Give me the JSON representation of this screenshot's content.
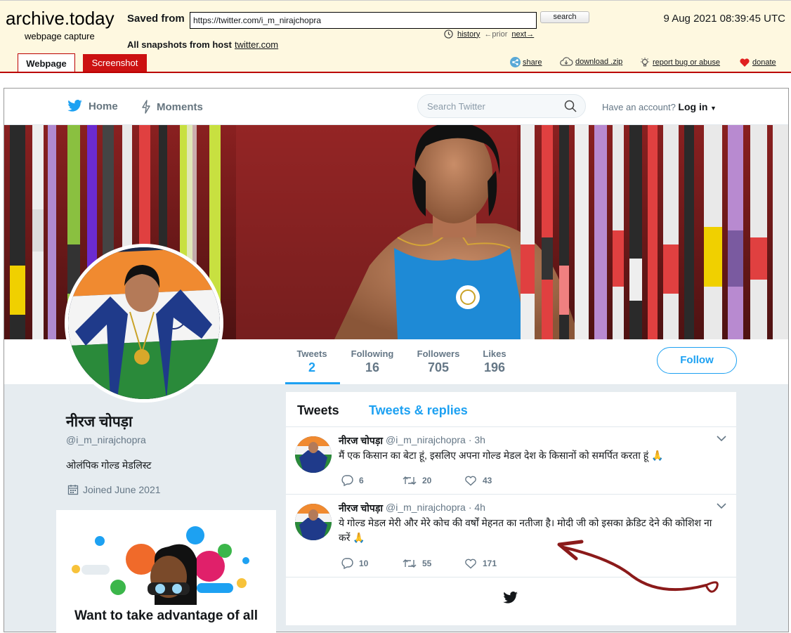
{
  "archive": {
    "logo": "archive.today",
    "subtitle": "webpage capture",
    "saved_from_label": "Saved from",
    "url": "https://twitter.com/i_m_nirajchopra",
    "search_label": "search",
    "timestamp": "9 Aug 2021 08:39:45 UTC",
    "history_label": "history",
    "prior_label": "←prior",
    "next_label": "next→",
    "snapshots_label": "All snapshots  from host",
    "host": "twitter.com",
    "tabs": {
      "webpage": "Webpage",
      "screenshot": "Screenshot"
    },
    "actions": {
      "share": "share",
      "download": "download .zip",
      "report": "report bug or abuse",
      "donate": "donate"
    }
  },
  "twitter": {
    "nav": {
      "home": "Home",
      "moments": "Moments"
    },
    "search_placeholder": "Search Twitter",
    "login_prefix": "Have an account?",
    "login_label": "Log in",
    "stats": [
      {
        "label": "Tweets",
        "value": "2"
      },
      {
        "label": "Following",
        "value": "16"
      },
      {
        "label": "Followers",
        "value": "705"
      },
      {
        "label": "Likes",
        "value": "196"
      }
    ],
    "follow_label": "Follow",
    "profile": {
      "name": "नीरज चोपड़ा",
      "handle": "@i_m_nirajchopra",
      "bio": "ओलंपिक गोल्ड मेडलिस्ट",
      "joined": "Joined June 2021"
    },
    "promo_title": "Want to take advantage of all",
    "timeline_tabs": {
      "tweets": "Tweets",
      "replies": "Tweets & replies"
    },
    "tweets": [
      {
        "name": "नीरज चोपड़ा",
        "handle": "@i_m_nirajchopra",
        "time": "· 3h",
        "text": "मैं एक किसान का बेटा हूं, इसलिए अपना गोल्ड मेडल देश के किसानों को समर्पित करता हूं 🙏",
        "replies": "6",
        "retweets": "20",
        "likes": "43"
      },
      {
        "name": "नीरज चोपड़ा",
        "handle": "@i_m_nirajchopra",
        "time": "· 4h",
        "text": "ये गोल्ड मेडल मेरी और मेरे कोच की वर्षों मेहनत का नतीजा है। मोदी जी को इसका क्रेडिट देने की कोशिश ना करें 🙏",
        "replies": "10",
        "retweets": "55",
        "likes": "171"
      }
    ]
  },
  "colors": {
    "accent": "#1da1f2",
    "archive_red": "#cc1111",
    "archive_bg": "#fef8e0",
    "annotation_arrow": "#8b1a1a"
  }
}
